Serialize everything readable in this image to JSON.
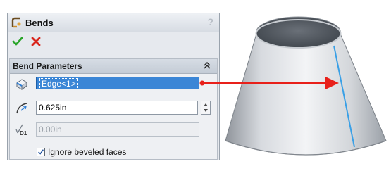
{
  "panel": {
    "title": "Bends",
    "help_label": "?",
    "ok_icon": "checkmark-icon",
    "cancel_icon": "x-icon"
  },
  "bend_parameters": {
    "title": "Bend Parameters",
    "selection_item": "Edge<1>",
    "radius_value": "0.625in",
    "d1_value": "0.00in",
    "d1_label": "D1",
    "ignore_beveled_label": "Ignore beveled faces",
    "ignore_beveled_checked": true
  },
  "colors": {
    "ok_green": "#2aa52a",
    "cancel_red": "#d8251c",
    "selection_blue": "#3b86d6",
    "arrow_red": "#e8201a",
    "edge_highlight": "#3aa0e6"
  }
}
